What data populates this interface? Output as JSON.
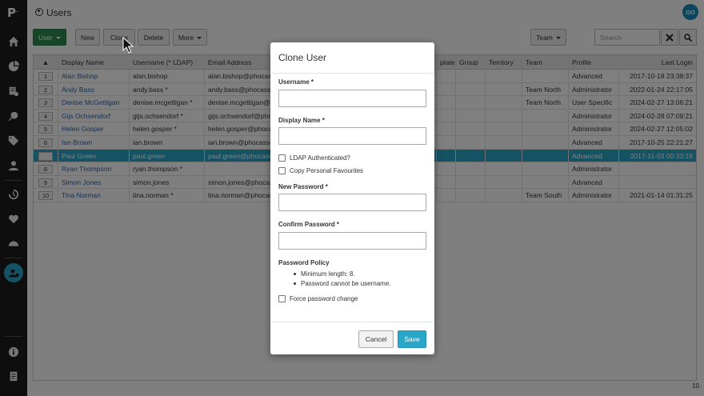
{
  "app": {
    "logo": "P",
    "logo_mark": "."
  },
  "header": {
    "title": "Users",
    "avatar_initials": "GO"
  },
  "toolbar": {
    "user_label": "User",
    "new_label": "New",
    "clone_label": "Clone",
    "delete_label": "Delete",
    "more_label": "More",
    "team_label": "Team",
    "search_placeholder": "Search"
  },
  "grid": {
    "columns": [
      "",
      "Display Name",
      "Username (* LDAP)",
      "Email Address",
      "",
      "",
      "plate",
      "Group",
      "Territory",
      "Team",
      "Profile",
      "Last Login"
    ],
    "sort_indicator": "▲",
    "rows": [
      {
        "num": "1",
        "name": "Alan Bishop",
        "username": "alan.bishop",
        "email": "alan.bishop@phocas",
        "team": "",
        "profile": "Advanced",
        "last": "2017-10-18 23:38:37"
      },
      {
        "num": "2",
        "name": "Andy Bass",
        "username": "andy.bass *",
        "email": "andy.bass@phocasso",
        "team": "Team North",
        "profile": "Administrator",
        "last": "2022-01-24 22:17:05"
      },
      {
        "num": "3",
        "name": "Denise McGettigan",
        "username": "denise.mcgettigan *",
        "email": "denise.mcgettigan@p",
        "team": "Team North",
        "profile": "User Specific",
        "last": "2024-02-27 13:06:21"
      },
      {
        "num": "4",
        "name": "Gijs Ochsendorf",
        "username": "gijs.ochsendorf *",
        "email": "gijs.ochsendorf@pho",
        "team": "",
        "profile": "Administrator",
        "last": "2024-02-28 07:09:21"
      },
      {
        "num": "5",
        "name": "Helen Gosper",
        "username": "helen.gosper *",
        "email": "helen.gosper@phoca",
        "team": "",
        "profile": "Administrator",
        "last": "2024-02-27 12:05:02"
      },
      {
        "num": "6",
        "name": "Ian Brown",
        "username": "ian.brown",
        "email": "ian.brown@phocasso",
        "team": "",
        "profile": "Advanced",
        "last": "2017-10-25 22:21:27"
      },
      {
        "num": "7",
        "name": "Paul Green",
        "username": "paul.green",
        "email": "paul.green@phocaso",
        "team": "",
        "profile": "Advanced",
        "last": "2017-11-03 00:33:16"
      },
      {
        "num": "8",
        "name": "Ryan Thompson",
        "username": "ryan.thompson *",
        "email": "",
        "team": "",
        "profile": "Administrator",
        "last": ""
      },
      {
        "num": "9",
        "name": "Simon Jones",
        "username": "simon.jones",
        "email": "simon.jones@phocas",
        "team": "",
        "profile": "Advanced",
        "last": ""
      },
      {
        "num": "10",
        "name": "Tina Norman",
        "username": "tina.norman *",
        "email": "tina.norman@phocas",
        "team": "Team South",
        "profile": "Administrator",
        "last": "2021-01-14 01:31:25"
      }
    ],
    "selected_row": "7",
    "footer_count": "10"
  },
  "modal": {
    "title": "Clone User",
    "username_label": "Username *",
    "display_name_label": "Display Name *",
    "ldap_label": "LDAP Authenticated?",
    "copy_favourites_label": "Copy Personal Favourites",
    "new_password_label": "New Password *",
    "confirm_password_label": "Confirm Password *",
    "policy_title": "Password Policy",
    "policy_items": [
      "Minimum length: 8.",
      "Password cannot be username."
    ],
    "force_change_label": "Force password change",
    "cancel_label": "Cancel",
    "save_label": "Save"
  },
  "colors": {
    "accent": "#2aa6c9",
    "user_button": "#2e8b4e",
    "sidebar": "#1c1c1c",
    "link": "#2f63a8"
  }
}
